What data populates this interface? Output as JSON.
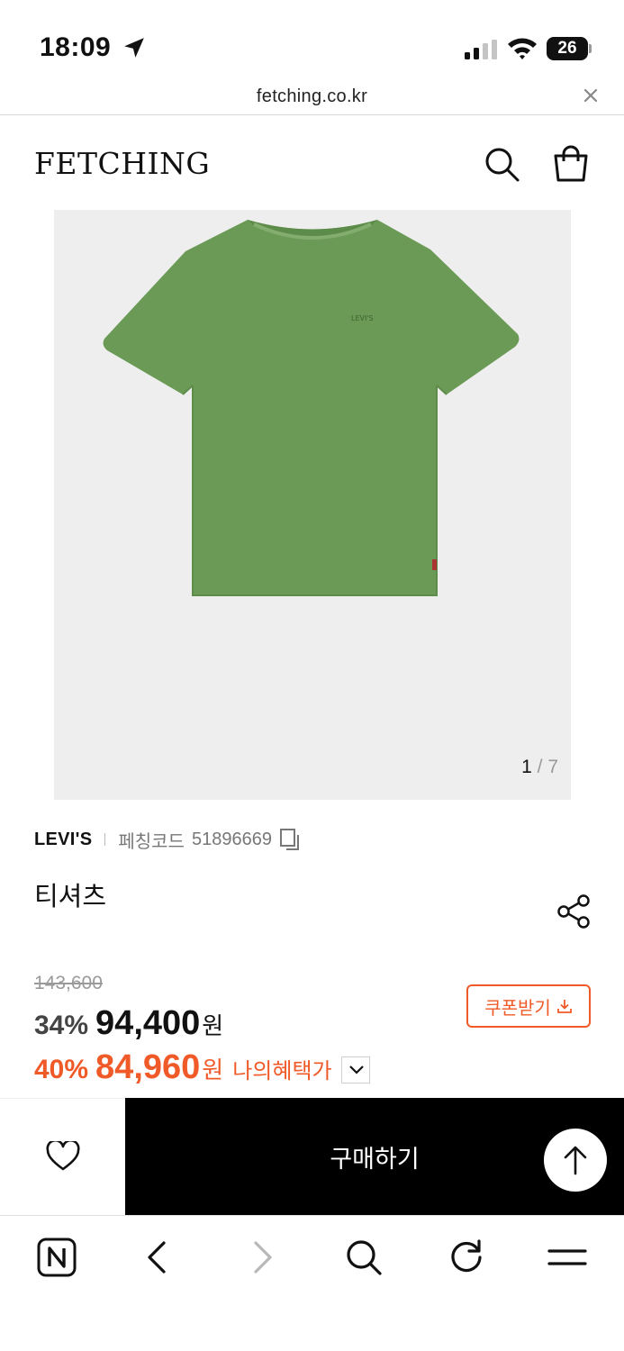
{
  "status_bar": {
    "time": "18:09",
    "battery": "26"
  },
  "url_bar": {
    "url": "fetching.co.kr"
  },
  "header": {
    "logo": "FETCHING"
  },
  "gallery": {
    "current": "1",
    "separator": "/",
    "total": "7"
  },
  "product": {
    "brand": "LEVI'S",
    "code_label": "페칭코드",
    "code": "51896669",
    "name": "티셔츠"
  },
  "pricing": {
    "original_price": "143,600",
    "discount_pct": "34%",
    "sale_price": "94,400",
    "currency": "원",
    "benefit_pct": "40%",
    "benefit_price": "84,960",
    "benefit_label": "나의혜택가",
    "coupon_label": "쿠폰받기"
  },
  "actions": {
    "buy_label": "구매하기"
  },
  "colors": {
    "accent": "#f05a28",
    "shirt": "#6a9a55",
    "image_bg": "#eeeeee"
  }
}
